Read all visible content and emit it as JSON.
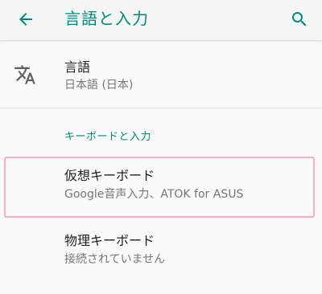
{
  "header": {
    "title": "言語と入力"
  },
  "language_row": {
    "title": "言語",
    "subtitle": "日本語 (日本)"
  },
  "section": {
    "header": "キーボードと入力"
  },
  "virtual_keyboard_row": {
    "title": "仮想キーボード",
    "subtitle": "Google音声入力、ATOK for ASUS"
  },
  "physical_keyboard_row": {
    "title": "物理キーボード",
    "subtitle": "接続されていません"
  },
  "colors": {
    "accent": "#00897b",
    "highlight": "#f4aeca"
  }
}
